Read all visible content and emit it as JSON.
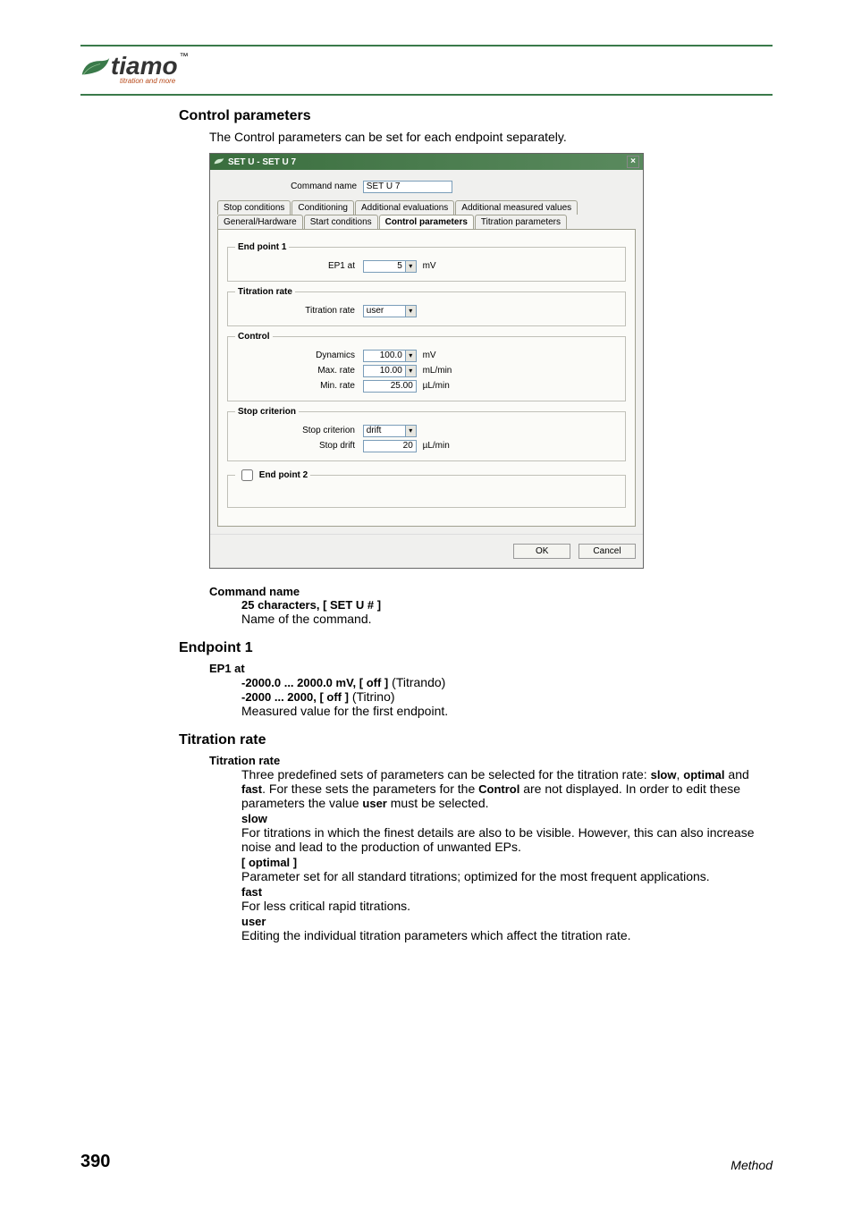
{
  "brand": {
    "name": "tiamo",
    "tm": "™",
    "sub": "titration and more"
  },
  "headings": {
    "control_parameters": "Control parameters",
    "endpoint1": "Endpoint 1",
    "titration_rate": "Titration rate"
  },
  "intro": "The Control parameters can be set for each endpoint separately.",
  "dialog": {
    "title": "SET U - SET U 7",
    "close": "×",
    "command_name_label": "Command name",
    "command_name_value": "SET U 7",
    "tabs_row1": [
      "Stop conditions",
      "Conditioning",
      "Additional evaluations",
      "Additional measured values"
    ],
    "tabs_row2": [
      "General/Hardware",
      "Start conditions",
      "Control parameters",
      "Titration parameters"
    ],
    "active_tab": "Control parameters",
    "groups": {
      "endpoint1": {
        "legend": "End point 1",
        "ep1_at_label": "EP1 at",
        "ep1_at_value": "5",
        "ep1_at_unit": "mV"
      },
      "titration_rate": {
        "legend": "Titration rate",
        "label": "Titration rate",
        "value": "user"
      },
      "control": {
        "legend": "Control",
        "dynamics_label": "Dynamics",
        "dynamics_value": "100.0",
        "dynamics_unit": "mV",
        "max_label": "Max. rate",
        "max_value": "10.00",
        "max_unit": "mL/min",
        "min_label": "Min. rate",
        "min_value": "25.00",
        "min_unit": "µL/min"
      },
      "stop_criterion": {
        "legend": "Stop criterion",
        "criterion_label": "Stop criterion",
        "criterion_value": "drift",
        "drift_label": "Stop drift",
        "drift_value": "20",
        "drift_unit": "µL/min"
      },
      "endpoint2_label": "End point 2"
    },
    "buttons": {
      "ok": "OK",
      "cancel": "Cancel"
    }
  },
  "terms": {
    "command_name": {
      "label": "Command name",
      "constraint": "25 characters, [ SET U # ]",
      "desc": "Name of the command."
    },
    "ep1_at": {
      "label": "EP1 at",
      "line1_bold": "-2000.0 ... 2000.0 mV, [ off ]",
      "line1_tail": " (Titrando)",
      "line2_bold": "-2000 ... 2000, [ off ]",
      "line2_tail": " (Titrino)",
      "desc": "Measured value for the first endpoint."
    },
    "titration_rate": {
      "label": "Titration rate",
      "intro_pre": "Three predefined sets of parameters can be selected for the titration rate: ",
      "slow_b": "slow",
      "sep1": ", ",
      "optimal_b": "optimal",
      "sep2": " and ",
      "fast_b": "fast",
      "intro_post1": ". For these sets the parameters for the ",
      "control_b": "Control",
      "intro_post2": " are not displayed. In order to edit these parameters the value ",
      "user_b": "user",
      "intro_post3": " must be selected.",
      "slow_label": "slow",
      "slow_desc": "For titrations in which the finest details are also to be visible. However, this can also increase noise and lead to the production of unwanted EPs.",
      "optimal_label": "[ optimal ]",
      "optimal_desc": "Parameter set for all standard titrations; optimized for the most frequent applications.",
      "fast_label": "fast",
      "fast_desc": "For less critical rapid titrations.",
      "user_label": "user",
      "user_desc": "Editing the individual titration parameters which affect the titration rate."
    }
  },
  "footer": {
    "page": "390",
    "label": "Method"
  }
}
